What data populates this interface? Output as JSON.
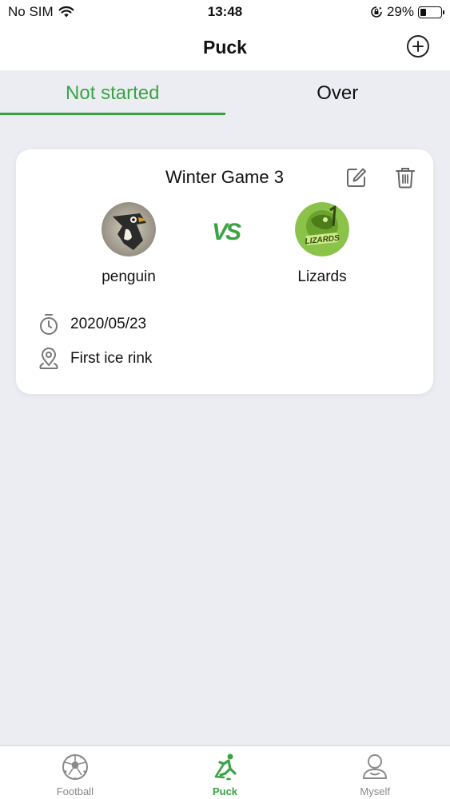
{
  "status_bar": {
    "carrier": "No SIM",
    "time": "13:48",
    "battery_percent": "29%",
    "battery_level": 0.29,
    "icons": [
      "wifi-icon",
      "orientation-lock-icon",
      "battery-icon"
    ]
  },
  "nav": {
    "title": "Puck",
    "add_icon": "plus-circle-icon"
  },
  "tabs": [
    {
      "label": "Not started",
      "active": true
    },
    {
      "label": "Over",
      "active": false
    }
  ],
  "game": {
    "title": "Winter Game 3",
    "edit_icon": "edit-icon",
    "delete_icon": "trash-icon",
    "home_team": {
      "name": "penguin",
      "logo": "penguin-logo"
    },
    "away_team": {
      "name": "Lizards",
      "logo": "lizards-logo"
    },
    "vs_label": "VS",
    "date": "2020/05/23",
    "date_icon": "stopwatch-icon",
    "location": "First ice rink",
    "location_icon": "location-pin-icon"
  },
  "tab_bar": [
    {
      "label": "Football",
      "icon": "soccer-ball-icon",
      "active": false
    },
    {
      "label": "Puck",
      "icon": "hockey-player-icon",
      "active": true
    },
    {
      "label": "Myself",
      "icon": "user-icon",
      "active": false
    }
  ],
  "colors": {
    "accent": "#3aa345",
    "background": "#ecedf2",
    "card": "#ffffff",
    "inactive": "#888888"
  }
}
